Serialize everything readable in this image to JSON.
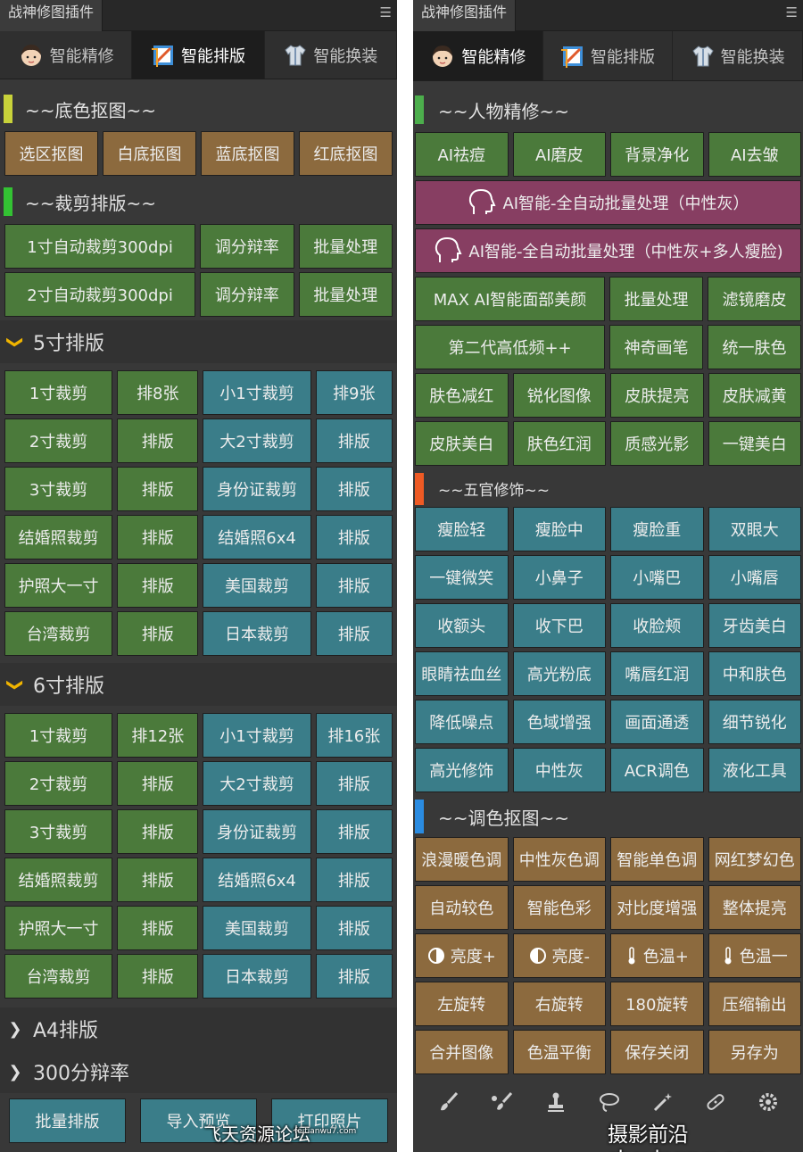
{
  "left": {
    "panel_title": "战神修图插件",
    "tabs": [
      {
        "label": "智能精修"
      },
      {
        "label": "智能排版"
      },
      {
        "label": "智能换装"
      }
    ],
    "section1": {
      "title": "~~底色抠图~~",
      "color": "#c8d23a",
      "buttons": [
        "选区抠图",
        "白底抠图",
        "蓝底抠图",
        "红底抠图"
      ]
    },
    "section2": {
      "title": "~~裁剪排版~~",
      "color": "#33c233",
      "rows": [
        [
          "1寸自动裁剪300dpi",
          "调分辩率",
          "批量处理"
        ],
        [
          "2寸自动裁剪300dpi",
          "调分辩率",
          "批量处理"
        ]
      ]
    },
    "group5": {
      "title": "5寸排版",
      "rows": [
        [
          "1寸裁剪",
          "排8张",
          "小1寸裁剪",
          "排9张"
        ],
        [
          "2寸裁剪",
          "排版",
          "大2寸裁剪",
          "排版"
        ],
        [
          "3寸裁剪",
          "排版",
          "身份证裁剪",
          "排版"
        ],
        [
          "结婚照裁剪",
          "排版",
          "结婚照6x4",
          "排版"
        ],
        [
          "护照大一寸",
          "排版",
          "美国裁剪",
          "排版"
        ],
        [
          "台湾裁剪",
          "排版",
          "日本裁剪",
          "排版"
        ]
      ]
    },
    "group6": {
      "title": "6寸排版",
      "rows": [
        [
          "1寸裁剪",
          "排12张",
          "小1寸裁剪",
          "排16张"
        ],
        [
          "2寸裁剪",
          "排版",
          "大2寸裁剪",
          "排版"
        ],
        [
          "3寸裁剪",
          "排版",
          "身份证裁剪",
          "排版"
        ],
        [
          "结婚照裁剪",
          "排版",
          "结婚照6x4",
          "排版"
        ],
        [
          "护照大一寸",
          "排版",
          "美国裁剪",
          "排版"
        ],
        [
          "台湾裁剪",
          "排版",
          "日本裁剪",
          "排版"
        ]
      ]
    },
    "groupA4": {
      "title": "A4排版"
    },
    "group300": {
      "title": "300分辩率"
    },
    "bottom": [
      "批量排版",
      "导入预览",
      "打印照片"
    ]
  },
  "right": {
    "panel_title": "战神修图插件",
    "tabs": [
      {
        "label": "智能精修"
      },
      {
        "label": "智能排版"
      },
      {
        "label": "智能换装"
      }
    ],
    "section1": {
      "title": "~~人物精修~~",
      "color": "#4cae4c",
      "row1": [
        "AI祛痘",
        "AI磨皮",
        "背景净化",
        "AI去皱"
      ],
      "ai1": "AI智能-全自动批量处理（中性灰）",
      "ai2": "AI智能-全自动批量处理（中性灰+多人瘦脸)",
      "ai_icon_text": "AI",
      "row_max": [
        "MAX AI智能面部美颜",
        "批量处理",
        "滤镜磨皮"
      ],
      "row_gen": [
        "第二代高低频++",
        "神奇画笔",
        "统一肤色"
      ],
      "row_a": [
        "肤色减红",
        "锐化图像",
        "皮肤提亮",
        "皮肤减黄"
      ],
      "row_b": [
        "皮肤美白",
        "肤色红润",
        "质感光影",
        "一键美白"
      ]
    },
    "section2": {
      "title": "~~五官修饰~~",
      "color": "#ee5a24",
      "rows": [
        [
          "瘦脸轻",
          "瘦脸中",
          "瘦脸重",
          "双眼大"
        ],
        [
          "一键微笑",
          "小鼻子",
          "小嘴巴",
          "小嘴唇"
        ],
        [
          "收额头",
          "收下巴",
          "收脸颊",
          "牙齿美白"
        ],
        [
          "眼睛祛血丝",
          "高光粉底",
          "嘴唇红润",
          "中和肤色"
        ],
        [
          "降低噪点",
          "色域增强",
          "画面通透",
          "细节锐化"
        ],
        [
          "高光修饰",
          "中性灰",
          "ACR调色",
          "液化工具"
        ]
      ]
    },
    "section3": {
      "title": "~~调色抠图~~",
      "color": "#2a8be0",
      "row1": [
        "浪漫暖色调",
        "中性灰色调",
        "智能单色调",
        "网红梦幻色"
      ],
      "row2": [
        "自动较色",
        "智能色彩",
        "对比度增强",
        "整体提亮"
      ],
      "row3": [
        {
          "label": "亮度+",
          "icon": "contrast-icon"
        },
        {
          "label": "亮度-",
          "icon": "contrast-icon"
        },
        {
          "label": "色温+",
          "icon": "thermometer-icon"
        },
        {
          "label": "色温一",
          "icon": "thermometer-icon"
        }
      ],
      "row4": [
        "左旋转",
        "右旋转",
        "180旋转",
        "压缩输出"
      ],
      "row5": [
        "合并图像",
        "色温平衡",
        "保存关闭",
        "另存为"
      ]
    },
    "tools": [
      "brush-icon",
      "mixer-brush-icon",
      "stamp-icon",
      "lasso-icon",
      "magic-wand-icon",
      "healing-brush-icon",
      "gear-icon"
    ]
  },
  "watermarks": {
    "left": "飞天资源论坛",
    "left_small": "feitianwu7.com",
    "right": "摄影前沿 sheyingzyz.com"
  }
}
